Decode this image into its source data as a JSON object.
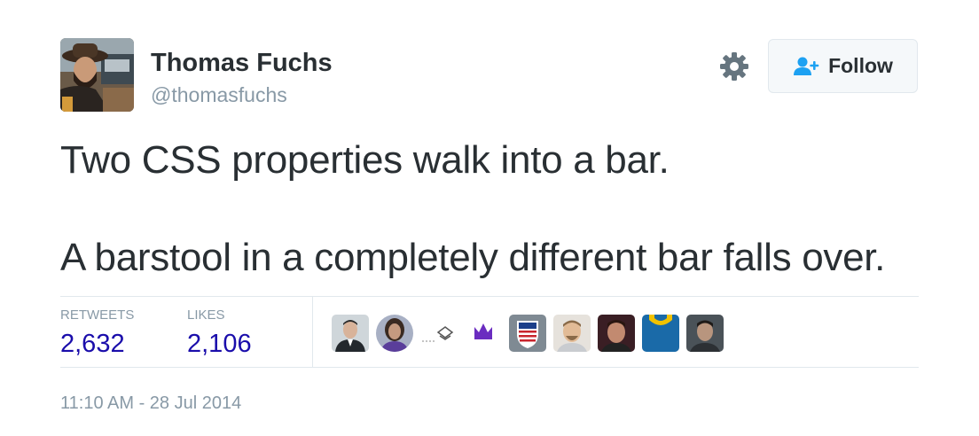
{
  "author": {
    "name": "Thomas Fuchs",
    "handle": "@thomasfuchs",
    "avatar_icon": "profile-photo-man-in-hat"
  },
  "actions": {
    "settings_icon": "gear-icon",
    "follow_label": "Follow",
    "follow_icon": "add-user-icon",
    "accent_color": "#1da1f2"
  },
  "tweet": {
    "line1": "Two CSS properties walk into a bar.",
    "line2": "A barstool in a completely different bar falls over."
  },
  "stats": {
    "retweets_label": "RETWEETS",
    "retweets_value": "2,632",
    "likes_label": "LIKES",
    "likes_value": "2,106",
    "value_color": "#1a0dab"
  },
  "likers": [
    {
      "name": "liker-avatar-1",
      "icon": "man-in-suit"
    },
    {
      "name": "liker-avatar-2",
      "icon": "woman-portrait"
    },
    {
      "name": "liker-avatar-3",
      "icon": "sketch-logo"
    },
    {
      "name": "liker-avatar-4",
      "icon": "purple-crown-logo"
    },
    {
      "name": "liker-avatar-5",
      "icon": "usa-shield-badge"
    },
    {
      "name": "liker-avatar-6",
      "icon": "smiling-man"
    },
    {
      "name": "liker-avatar-7",
      "icon": "man-dark-background"
    },
    {
      "name": "liker-avatar-8",
      "icon": "yellow-blue-logo"
    },
    {
      "name": "liker-avatar-9",
      "icon": "young-man-portrait"
    }
  ],
  "timestamp": "11:10 AM - 28 Jul 2014"
}
